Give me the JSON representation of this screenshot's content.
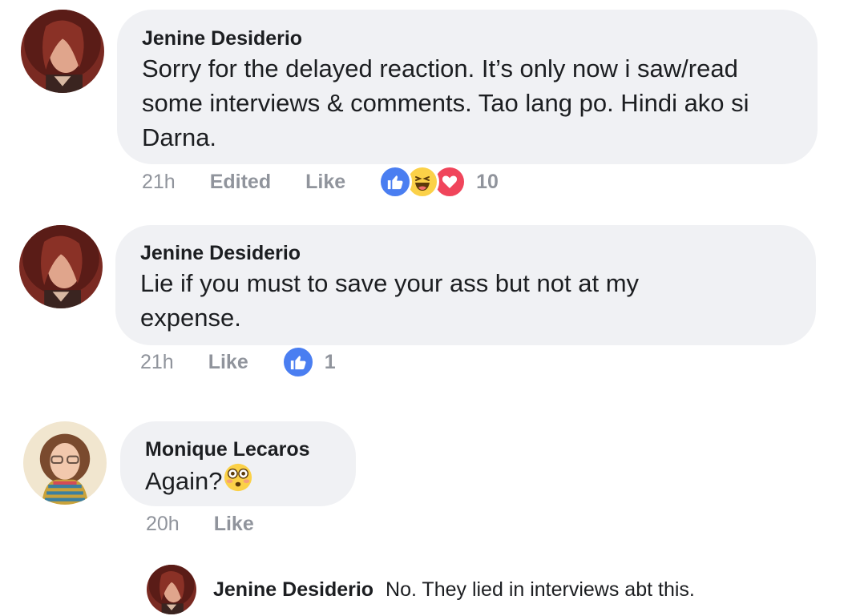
{
  "comments": [
    {
      "author": "Jenine Desiderio",
      "text": "Sorry for the delayed reaction. It’s only now i saw/read some interviews & comments. Tao lang po. Hindi ako si Darna.",
      "time": "21h",
      "edited_label": "Edited",
      "like_label": "Like",
      "reactions": [
        "like-icon",
        "haha-icon",
        "love-icon"
      ],
      "reaction_count": "10"
    },
    {
      "author": "Jenine Desiderio",
      "text": "Lie if you must to save your ass but not at my expense.",
      "time": "21h",
      "like_label": "Like",
      "reactions": [
        "like-icon"
      ],
      "reaction_count": "1"
    },
    {
      "author": "Monique Lecaros",
      "text": "Again?",
      "emoji": "flushed-face-icon",
      "time": "20h",
      "like_label": "Like"
    }
  ],
  "reply": {
    "author": "Jenine Desiderio",
    "text": "No. They lied in interviews abt this."
  },
  "colors": {
    "bubble": "#f0f1f4",
    "meta_text": "#90949c",
    "like_blue": "#4a7ef1",
    "haha_yellow": "#fbd148",
    "love_red": "#f0455b"
  }
}
